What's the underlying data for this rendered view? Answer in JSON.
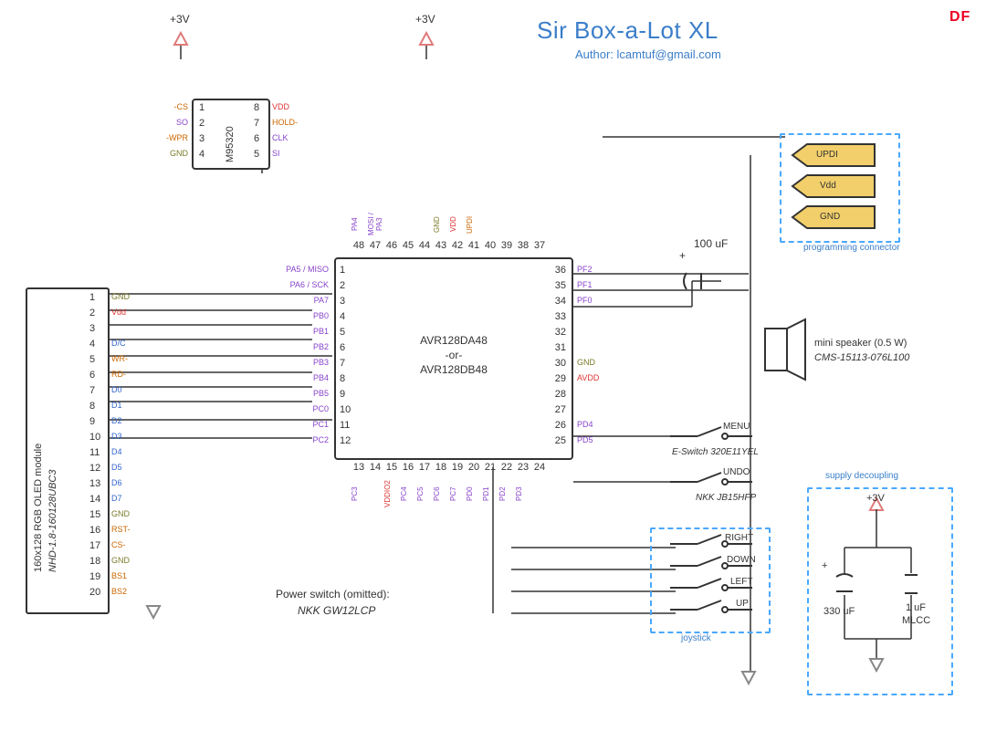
{
  "title": "Sir Box-a-Lot XL",
  "author": "Author: lcamtuf@gmail.com",
  "watermark": "DF",
  "rails": {
    "v3": "+3V"
  },
  "oled": {
    "name_line1": "160x128 RGB OLED module",
    "name_line2": "NHD-1.8-160128UBC3",
    "pins": [
      "1",
      "2",
      "3",
      "4",
      "5",
      "6",
      "7",
      "8",
      "9",
      "10",
      "11",
      "12",
      "13",
      "14",
      "15",
      "16",
      "17",
      "18",
      "19",
      "20"
    ],
    "pin_labels": [
      "GND",
      "Vdd",
      "",
      "D/C",
      "WR-",
      "RD-",
      "D0",
      "D1",
      "D2",
      "D3",
      "D4",
      "D5",
      "D6",
      "D7",
      "GND",
      "RST-",
      "CS-",
      "GND",
      "BS1",
      "BS2"
    ]
  },
  "eeprom": {
    "part": "M95320",
    "pins_left": [
      "1",
      "2",
      "3",
      "4"
    ],
    "pins_right": [
      "8",
      "7",
      "6",
      "5"
    ],
    "labels_left": [
      "-CS",
      "SO",
      "-WPR",
      "GND"
    ],
    "labels_right": [
      "VDD",
      "HOLD-",
      "CLK",
      "SI"
    ]
  },
  "mcu": {
    "line1": "AVR128DA48",
    "mid": "-or-",
    "line2": "AVR128DB48",
    "left_nums": [
      "1",
      "2",
      "3",
      "4",
      "5",
      "6",
      "7",
      "8",
      "9",
      "10",
      "11",
      "12"
    ],
    "left_labels": [
      "PA5 / MISO",
      "PA6 / SCK",
      "PA7",
      "PB0",
      "PB1",
      "PB2",
      "PB3",
      "PB4",
      "PB5",
      "PC0",
      "PC1",
      "PC2"
    ],
    "right_nums": [
      "36",
      "35",
      "34",
      "33",
      "32",
      "31",
      "30",
      "29",
      "28",
      "27",
      "26",
      "25"
    ],
    "right_labels": [
      "PF2",
      "PF1",
      "PF0",
      "",
      "",
      "",
      "GND",
      "AVDD",
      "",
      "",
      "PD4",
      "PD5"
    ],
    "top_nums": [
      "48",
      "47",
      "46",
      "45",
      "44",
      "43",
      "42",
      "41",
      "40",
      "39",
      "38",
      "37"
    ],
    "top_labels": [
      "PA4",
      "MOSI / PA3",
      "",
      "",
      "",
      "GND",
      "VDD",
      "UPDI",
      "",
      "",
      "",
      ""
    ],
    "bot_nums": [
      "13",
      "14",
      "15",
      "16",
      "17",
      "18",
      "19",
      "20",
      "21",
      "22",
      "23",
      "24"
    ],
    "bot_labels": [
      "PC3",
      "",
      "VDDIO2",
      "PC4",
      "PC5",
      "PC6",
      "PC7",
      "PD0",
      "PD1",
      "PD2",
      "PD3",
      ""
    ]
  },
  "prog": {
    "title": "programming connector",
    "labels": [
      "UPDI",
      "Vdd",
      "GND"
    ]
  },
  "cap100": "100 uF",
  "speaker": {
    "line1": "mini speaker (0.5 W)",
    "line2": "CMS-15113-076L100"
  },
  "buttons": {
    "menu": "MENU",
    "menu_part": "E-Switch 320E11YEL",
    "undo": "UNDO",
    "undo_part": "NKK JB15HFP"
  },
  "joystick": {
    "title": "joystick",
    "dirs": [
      "RIGHT",
      "DOWN",
      "LEFT",
      "UP"
    ]
  },
  "power_switch": {
    "line1": "Power switch (omitted):",
    "line2": "NKK GW12LCP"
  },
  "decoupling": {
    "title": "supply decoupling",
    "cap_big": "330 uF",
    "cap_small_1": "1 uF",
    "cap_small_2": "MLCC"
  }
}
